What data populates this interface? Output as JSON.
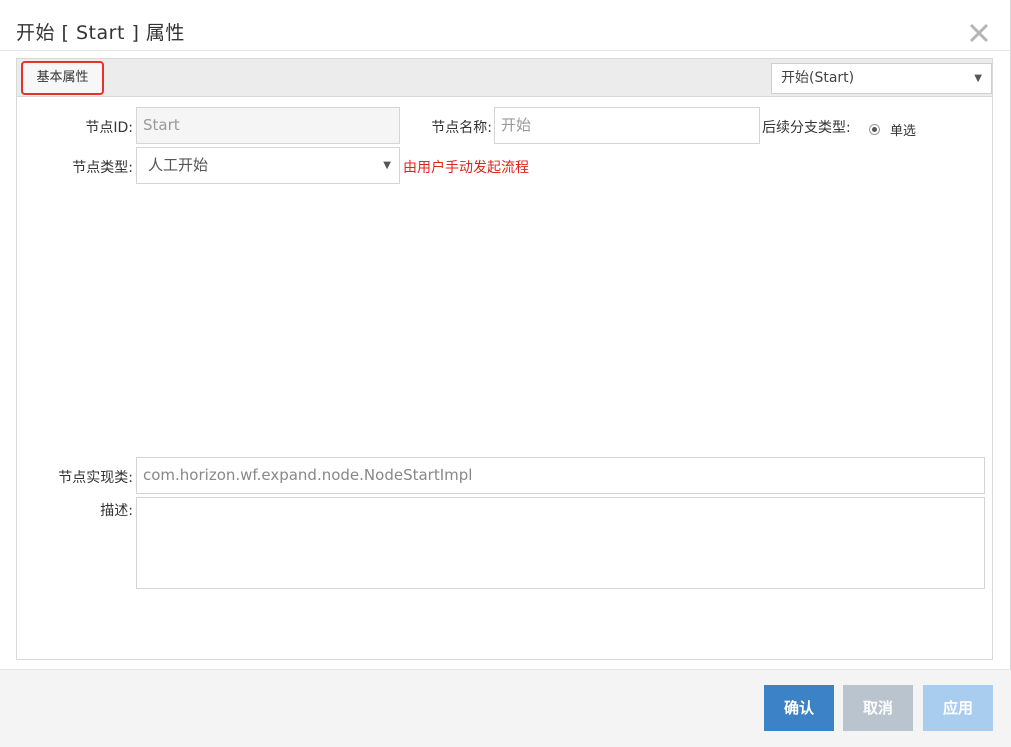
{
  "dialog": {
    "title": "开始 [ Start ] 属性"
  },
  "tabs": {
    "active_label": "基本属性"
  },
  "node_selector": {
    "value": "开始(Start)"
  },
  "form": {
    "node_id_label": "节点ID:",
    "node_id_value": "Start",
    "node_name_label": "节点名称:",
    "node_name_value": "开始",
    "branch_type_label": "后续分支类型:",
    "branch_type_option": "单选",
    "node_type_label": "节点类型:",
    "node_type_value": "人工开始",
    "node_type_hint": "由用户手动发起流程",
    "impl_class_label": "节点实现类:",
    "impl_class_value": "com.horizon.wf.expand.node.NodeStartImpl",
    "description_label": "描述:",
    "description_value": ""
  },
  "footer": {
    "confirm_label": "确认",
    "cancel_label": "取消",
    "apply_label": "应用"
  },
  "colors": {
    "primary_button": "#3b83c6",
    "cancel_button": "#b9c4cf",
    "apply_button": "#a9cdef",
    "hint_red": "#e0241b",
    "tab_highlight": "#e5322d"
  }
}
